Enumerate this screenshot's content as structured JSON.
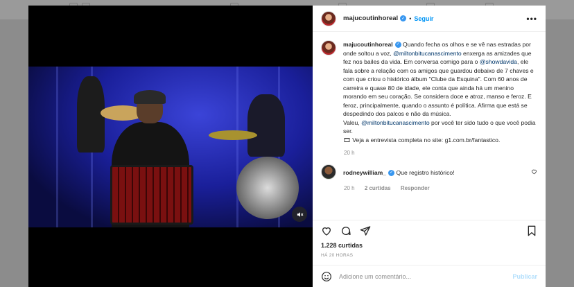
{
  "post": {
    "username": "majucoutinhoreal",
    "follow_label": "Seguir",
    "more_label": "•••",
    "caption": {
      "p1": " Quando fecha os olhos e se vê nas estradas por onde soltou a voz, ",
      "m1": "@miltonbitucanascimento",
      "p2": " enxerga as amizades que fez nos bailes da vida. Em conversa comigo para o ",
      "m2": "@showdavida",
      "p3": ", ele fala sobre a relação com os amigos que guardou debaixo de 7 chaves e com que criou o histórico álbum \"Clube da Esquina\". Com 60 anos de carreira e quase 80 de idade, ele conta que ainda há um menino morando em seu coração. Se considera doce e atroz, manso e feroz. E feroz, principalmente, quando o assunto é política. Afirma que está se despedindo dos palcos e não da música.",
      "p4": "Valeu, ",
      "m3": "@miltonbitucanascimento",
      "p5": " por você ter sido tudo o que você podia ser.",
      "p6": "🎞 Veja a entrevista completa no site: g1.com.br/fantastico."
    },
    "caption_time": "20 h",
    "comment": {
      "username": "rodneywilliam_",
      "text": " Que registro histórico!",
      "time": "20 h",
      "likes": "2 curtidas",
      "reply_label": "Responder"
    },
    "likes": "1.228 curtidas",
    "timestamp": "HÁ 20 HORAS",
    "add_comment_placeholder": "Adicione um comentário...",
    "publish_label": "Publicar"
  },
  "colors": {
    "accent": "#0095f6",
    "verified": "#3897f0",
    "publish_disabled": "#b2dffc",
    "muted_text": "#8e8e8e"
  }
}
